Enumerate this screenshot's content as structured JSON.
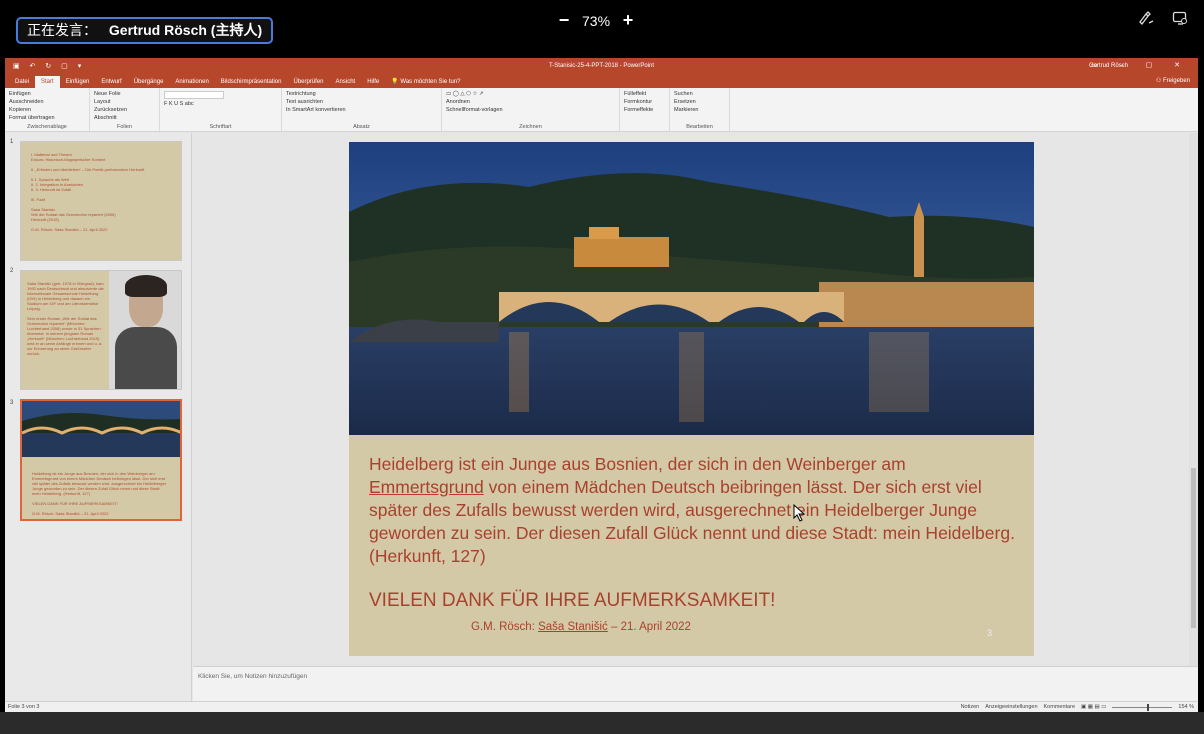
{
  "meeting": {
    "speaker_label": "正在发言：",
    "speaker_name": "Gertrud Rösch (主持人)",
    "zoom_level": "73%",
    "zoom_out_label": "−",
    "zoom_in_label": "+"
  },
  "ppt": {
    "title": "T-Stanisic-25-4-PPT-2018 - PowerPoint",
    "user": "Gertrud Rösch",
    "share_label": "Freigeben",
    "tabs": [
      "Datei",
      "Start",
      "Einfügen",
      "Entwurf",
      "Übergänge",
      "Animationen",
      "Bildschirmpräsentation",
      "Überprüfen",
      "Ansicht",
      "Hilfe",
      "Was möchten Sie tun?"
    ],
    "active_tab": "Start",
    "ribbon": {
      "clipboard": {
        "paste": "Einfügen",
        "cut": "Ausschneiden",
        "copy": "Kopieren",
        "format": "Format übertragen",
        "name": "Zwischenablage"
      },
      "slides": {
        "new": "Neue Folie",
        "layout": "Layout",
        "reset": "Zurücksetzen",
        "section": "Abschnitt",
        "name": "Folien"
      },
      "font": {
        "name": "Schriftart"
      },
      "paragraph": {
        "direction": "Textrichtung",
        "align": "Text ausrichten",
        "smartart": "In SmartArt konvertieren",
        "name": "Absatz"
      },
      "drawing": {
        "arrange": "Anordnen",
        "styles": "Schnellformat-vorlagen",
        "fill": "Fülleffekt",
        "outline": "Formkontur",
        "effects": "Formeffekte",
        "name": "Zeichnen"
      },
      "editing": {
        "find": "Suchen",
        "replace": "Ersetzen",
        "select": "Markieren",
        "name": "Bearbeiten"
      }
    },
    "thumbnails": [
      {
        "num": "1",
        "text": "I. Matterial und Thesen\nExkurs: Historisch-biographischer Kontext\n\nII. „Erfinden und überliefern“ – Die Poetik performativer Herkunft\n\nII.1. Sprache als Welt\nII. 2. Integration in Anekdoten\nII. 3. Herkunft ist Zufall\n\nIII. Fazit\n\nSasa Stanisic\nWie der Soldat das Grammofon repariert (2006)\nHerkunft (2019)\n\nG.M. Rösch: Saša Stanišić – 21. April 2022"
      },
      {
        "num": "2",
        "text": "Saša Stanišić (geb. 1978 in Višegrad), kam 1992 nach Deutschland und absolvierte die Internationale Gesamtschule Heidelberg (IGH) in Heidelberg und danach ein Studium am IGF und am Literaturinstitut Leipzig.\n\nSein erster Roman „Wie der Soldat das Grammofon repariert“ (München: Luchterhand 2006) wurde in 31 Sprachen übersetzt. In seinem jüngsten Roman „Herkunft“ (München: Luchterhand 2019) wird er an seine Anfänge erinnert und u. a. zur Erinnerung an seine Großmutter zurück."
      },
      {
        "num": "3",
        "text": "Heidelberg ist ein Junge aus Bosnien, der sich in den Weinberger am Emmertsgrund von einem Mädchen Deutsch beibringen lässt. Der sich erst viel später des Zufalls bewusst werden wird, ausgerechnet ein Heidelberger Junge geworden zu sein. Der diesen Zufall Glück nennt und diese Stadt: mein Heidelberg. (Herkunft, 127)\n\nVIELEN DANK FÜR IHRE AUFMERKSAMKEIT!\n\nG.M. Rösch: Saša Stanišić – 21. April 2022"
      }
    ],
    "slide": {
      "text_pre": "Heidelberg ist ein Junge aus Bosnien, der sich in den Weinberger am ",
      "text_ul": "Emmertsgrund",
      "text_post": " von einem Mädchen Deutsch beibringen lässt. Der sich erst viel später des Zufalls bewusst werden wird, ausgerechnet ein Heidelberger Junge geworden zu sein. Der diesen Zufall Glück nennt und diese Stadt: mein Heidelberg. (Herkunft, 127)",
      "thanks": "VIELEN DANK FÜR IHRE AUFMERKSAMKEIT!",
      "credit_pre": "G.M. Rösch: ",
      "credit_name": "Saša Stanišić",
      "credit_post": " –  21. April  2022",
      "number": "3"
    },
    "notes_placeholder": "Klicken Sie, um Notizen hinzuzufügen",
    "status": {
      "slide_info": "Folie 3 von 3",
      "notes": "Notizen",
      "display": "Anzeigeeinstellungen",
      "comments": "Kommentare",
      "zoom": "154 %"
    }
  },
  "colors": {
    "ppt_accent": "#b7472a",
    "slide_bg": "#d4c9a6",
    "slide_text": "#a8412d"
  }
}
